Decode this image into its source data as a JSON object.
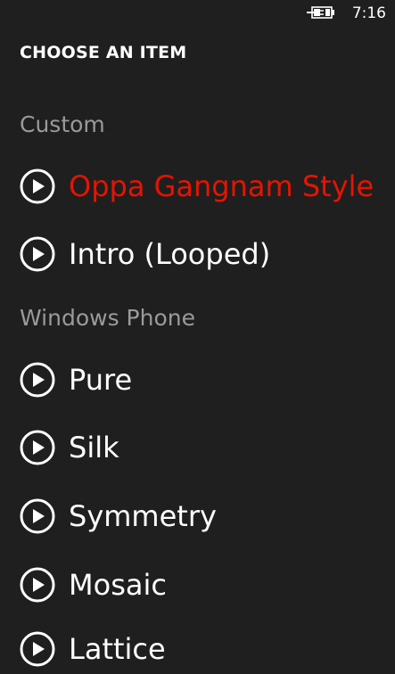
{
  "status": {
    "time": "7:16",
    "battery_icon": "battery-charging-icon"
  },
  "page": {
    "title": "CHOOSE AN ITEM"
  },
  "groups": [
    {
      "header": "Custom",
      "items": [
        {
          "label": "Oppa Gangnam Style",
          "selected": true,
          "icon": "play-circle-icon"
        },
        {
          "label": "Intro (Looped)",
          "selected": false,
          "icon": "play-circle-icon"
        }
      ]
    },
    {
      "header": "Windows Phone",
      "items": [
        {
          "label": "Pure",
          "selected": false,
          "icon": "play-circle-icon"
        },
        {
          "label": "Silk",
          "selected": false,
          "icon": "play-circle-icon"
        },
        {
          "label": "Symmetry",
          "selected": false,
          "icon": "play-circle-icon"
        },
        {
          "label": "Mosaic",
          "selected": false,
          "icon": "play-circle-icon"
        },
        {
          "label": "Lattice",
          "selected": false,
          "icon": "play-circle-icon"
        }
      ]
    }
  ],
  "colors": {
    "background": "#1f1f1f",
    "accent": "#e51400",
    "text": "#ffffff",
    "subtle": "#9a9a9a"
  }
}
